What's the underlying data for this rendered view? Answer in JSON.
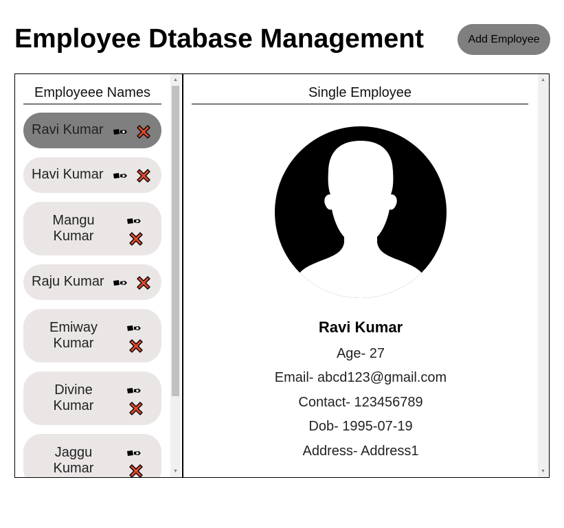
{
  "header": {
    "title": "Employee Dtabase Management",
    "add_button_label": "Add Employee"
  },
  "list": {
    "heading": "Employeee Names",
    "employees": [
      {
        "name": "Ravi Kumar",
        "selected": true
      },
      {
        "name": "Havi Kumar",
        "selected": false
      },
      {
        "name": "Mangu Kumar",
        "selected": false
      },
      {
        "name": "Raju Kumar",
        "selected": false
      },
      {
        "name": "Emiway Kumar",
        "selected": false
      },
      {
        "name": "Divine Kumar",
        "selected": false
      },
      {
        "name": "Jaggu Kumar",
        "selected": false
      }
    ],
    "edit_icon": "pen-icon",
    "delete_icon": "cross-icon",
    "delete_color": "#e04a2f"
  },
  "detail": {
    "heading": "Single Employee",
    "avatar_icon": "person-silhouette-icon",
    "name": "Ravi Kumar",
    "age": "Age- 27",
    "email": "Email- abcd123@gmail.com",
    "contact": "Contact- 123456789",
    "dob": "Dob- 1995-07-19",
    "address": "Address- Address1"
  },
  "colors": {
    "selected_item": "#7f7f7f",
    "item_bg": "#ebe6e6",
    "button_bg": "#7f7f7f"
  }
}
